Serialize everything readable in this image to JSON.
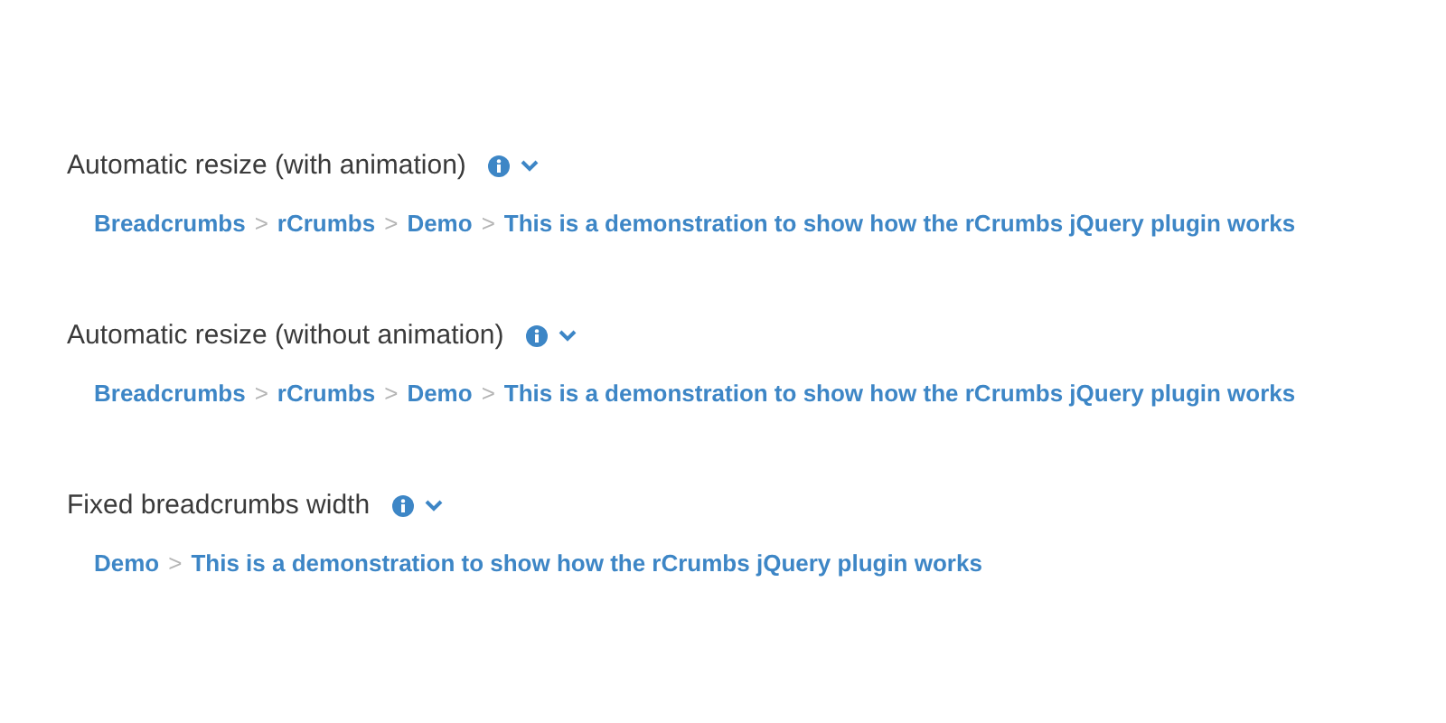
{
  "sections": [
    {
      "title": "Automatic resize (with animation)",
      "separator": ">",
      "crumbs": [
        "Breadcrumbs",
        "rCrumbs",
        "Demo",
        "This is a demonstration to show how the rCrumbs jQuery plugin works"
      ]
    },
    {
      "title": "Automatic resize (without animation)",
      "separator": ">",
      "crumbs": [
        "Breadcrumbs",
        "rCrumbs",
        "Demo",
        "This is a demonstration to show how the rCrumbs jQuery plugin works"
      ]
    },
    {
      "title": "Fixed breadcrumbs width",
      "separator": ">",
      "crumbs": [
        "Demo",
        "This is a demonstration to show how the rCrumbs jQuery plugin works"
      ]
    }
  ]
}
